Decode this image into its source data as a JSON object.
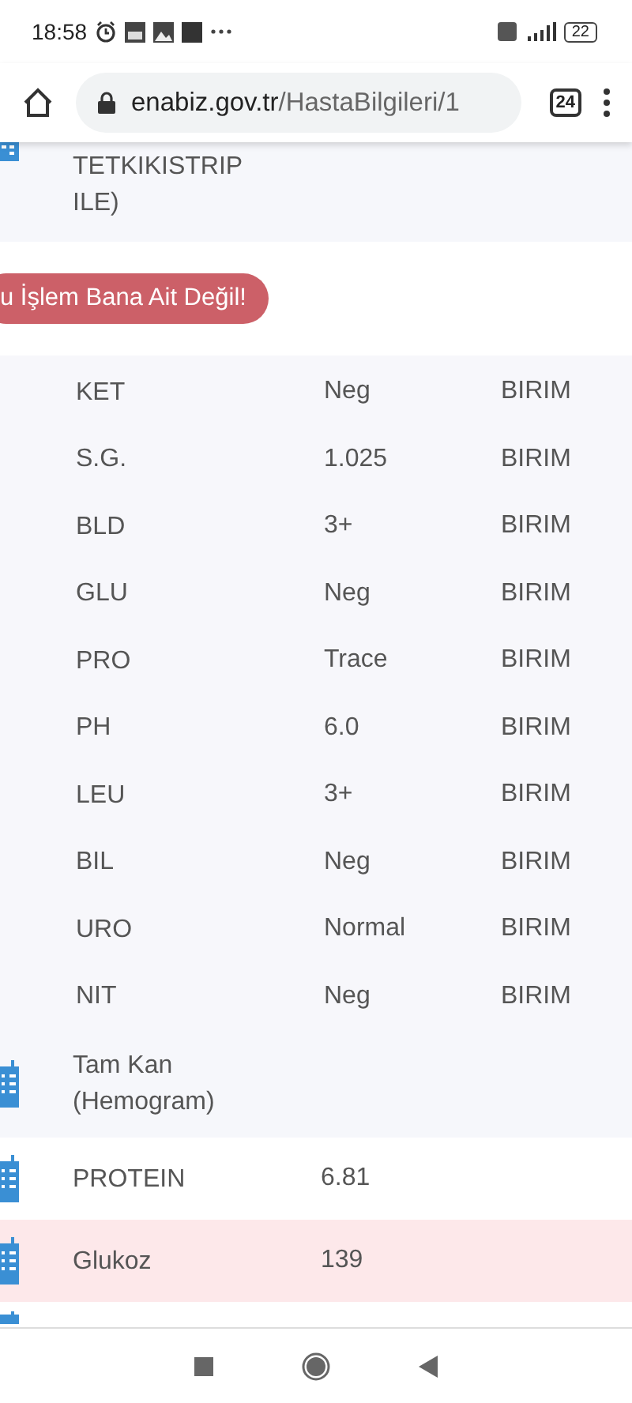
{
  "status_bar": {
    "time": "18:58",
    "battery": "22"
  },
  "browser": {
    "domain": "enabiz.gov.tr",
    "path": "/HastaBilgileri/1",
    "tab_count": "24"
  },
  "test_group": {
    "name": "TETKIKISTRIP ILE)"
  },
  "report_button": {
    "label": "u İşlem Bana Ait Değil!"
  },
  "results": [
    {
      "name": "KET",
      "value": "Neg",
      "unit": "BIRIM"
    },
    {
      "name": "S.G.",
      "value": "1.025",
      "unit": "BIRIM"
    },
    {
      "name": "BLD",
      "value": "3+",
      "unit": "BIRIM"
    },
    {
      "name": "GLU",
      "value": "Neg",
      "unit": "BIRIM"
    },
    {
      "name": "PRO",
      "value": "Trace",
      "unit": "BIRIM"
    },
    {
      "name": "PH",
      "value": "6.0",
      "unit": "BIRIM"
    },
    {
      "name": "LEU",
      "value": "3+",
      "unit": "BIRIM"
    },
    {
      "name": "BIL",
      "value": "Neg",
      "unit": "BIRIM"
    },
    {
      "name": "URO",
      "value": "Normal",
      "unit": "BIRIM"
    },
    {
      "name": "NIT",
      "value": "Neg",
      "unit": "BIRIM"
    }
  ],
  "tests": [
    {
      "kind": "group",
      "name": "Tam Kan (Hemogram)",
      "flagged": false
    },
    {
      "kind": "test",
      "name": "PROTEIN",
      "value": "6.81",
      "flagged": false
    },
    {
      "kind": "test",
      "name": "Glukoz",
      "value": "139",
      "flagged": true
    }
  ]
}
